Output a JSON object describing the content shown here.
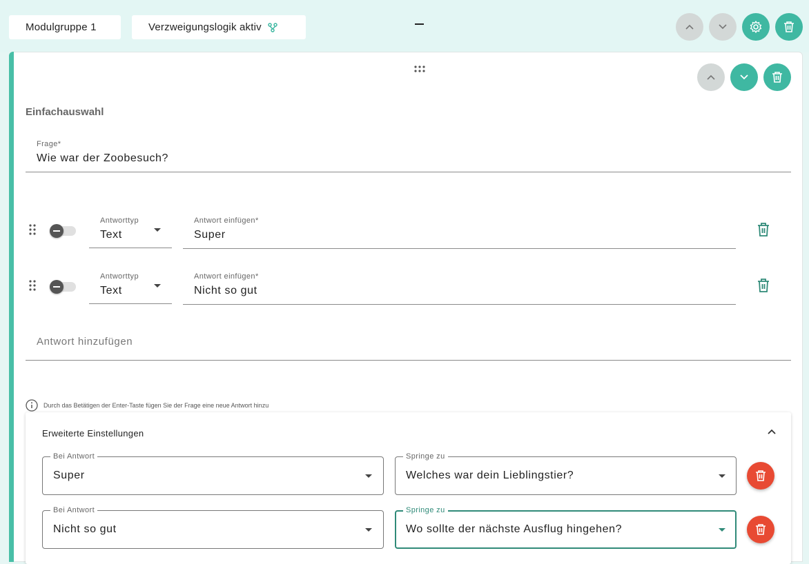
{
  "header": {
    "group_label": "Modulgruppe 1",
    "branching_label": "Verzweigungslogik aktiv",
    "collapse_symbol": "—"
  },
  "question_card": {
    "type_title": "Einfachauswahl",
    "question_field": {
      "label": "Frage*",
      "value": "Wie war der Zoobesuch?"
    },
    "answers": [
      {
        "type_label": "Antworttyp",
        "type_value": "Text",
        "answer_label": "Antwort einfügen*",
        "answer_value": "Super"
      },
      {
        "type_label": "Antworttyp",
        "type_value": "Text",
        "answer_label": "Antwort einfügen*",
        "answer_value": "Nicht so gut"
      }
    ],
    "add_answer_placeholder": "Antwort hinzufügen",
    "info_hint": "Durch das Betätigen der Enter-Taste fügen Sie der Frage eine neue Antwort hinzu",
    "advanced": {
      "title": "Erweiterte Einstellungen",
      "rules": [
        {
          "answer_label": "Bei Antwort",
          "answer_value": "Super",
          "jump_label": "Springe zu",
          "jump_value": "Welches war dein Lieblingstier?"
        },
        {
          "answer_label": "Bei Antwort",
          "answer_value": "Nicht so gut",
          "jump_label": "Springe zu",
          "jump_value": "Wo sollte der nächste Ausflug hingehen?"
        }
      ]
    }
  },
  "icons": {
    "branch": "branch-icon",
    "up": "chevron-up-icon",
    "down": "chevron-down-icon",
    "settings": "gear-icon",
    "delete": "trash-icon",
    "drag": "drag-handle-icon",
    "info": "info-icon"
  },
  "colors": {
    "accent": "#3fb8a2",
    "accent_dark": "#2f8a78",
    "danger": "#e84a33",
    "disabled": "#d3d8d7",
    "background": "#e6f6f4"
  }
}
